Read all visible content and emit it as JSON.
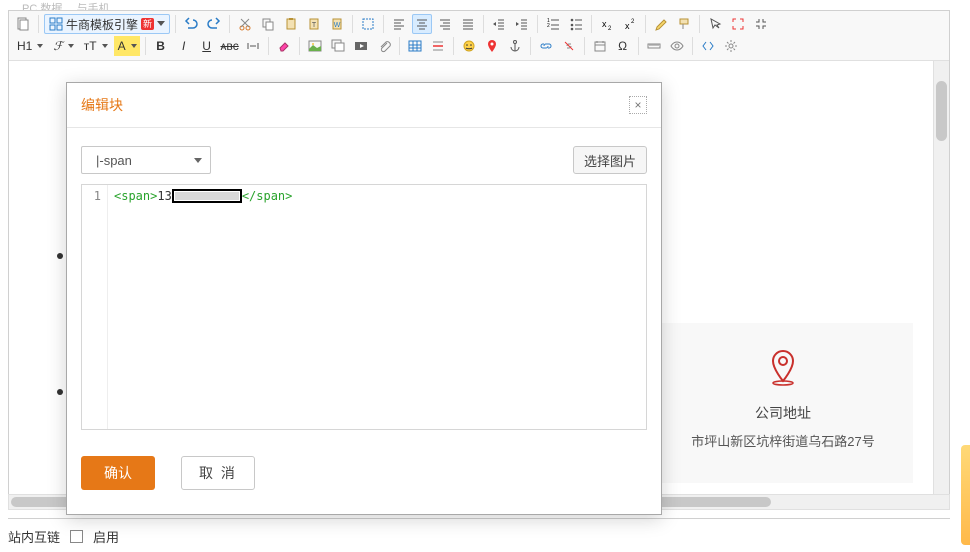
{
  "breadcrumb_fragment": "… PC 数据… 与手机",
  "toolbar": {
    "template_btn_label": "牛商模板引擎",
    "template_btn_badge": "新",
    "heading_combo": "H1",
    "font_family_combo": "ℱ",
    "font_size_combo": "ᴛT",
    "highlight_combo": "A"
  },
  "modal": {
    "title": "编辑块",
    "element_type": "|-span",
    "choose_image": "选择图片",
    "line_no": "1",
    "code_open_tag": "<span>",
    "code_text_prefix": "13",
    "code_close_tag": "</span>",
    "ok": "确认",
    "cancel": "取 消"
  },
  "address_card": {
    "title": "公司地址",
    "value": "市坪山新区坑梓街道乌石路27号"
  },
  "footer": {
    "interlink_label": "站内互链",
    "enable_label": "启用"
  }
}
